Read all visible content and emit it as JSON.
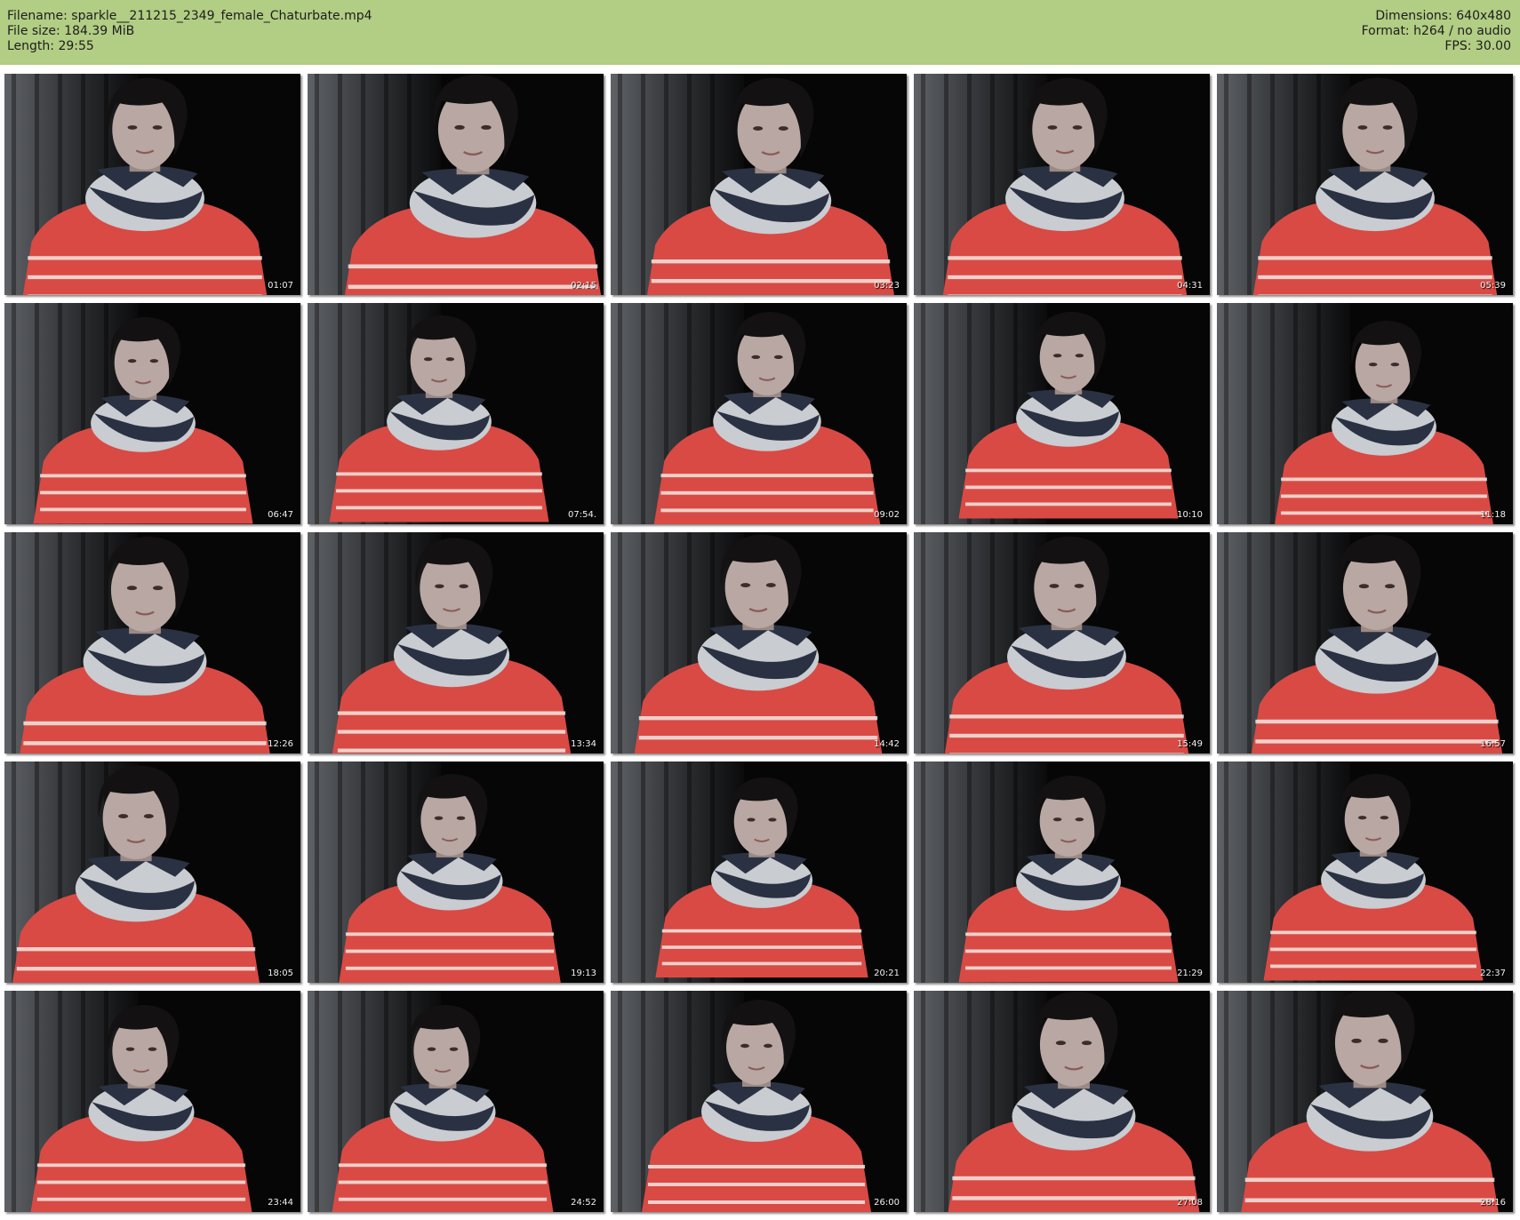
{
  "header": {
    "filename": "Filename: sparkle__211215_2349_female_Chaturbate.mp4",
    "filesize": "File size: 184.39 MiB",
    "length": "Length: 29:55",
    "dimensions": "Dimensions: 640x480",
    "format": "Format: h264 / no audio",
    "fps": "FPS: 30.00"
  },
  "colors": {
    "header_bg": "#b2cd84",
    "sweater": "#d94a45",
    "scarf_dark": "#2a3142",
    "scarf_light": "#c9ccd0",
    "curtain": "#5f6266"
  },
  "thumbnails": [
    {
      "timestamp": "01:07"
    },
    {
      "timestamp": "02:15"
    },
    {
      "timestamp": "03:23"
    },
    {
      "timestamp": "04:31"
    },
    {
      "timestamp": "05:39"
    },
    {
      "timestamp": "06:47"
    },
    {
      "timestamp": "07:54."
    },
    {
      "timestamp": "09:02"
    },
    {
      "timestamp": "10:10"
    },
    {
      "timestamp": "11:18"
    },
    {
      "timestamp": "12:26"
    },
    {
      "timestamp": "13:34"
    },
    {
      "timestamp": "14:42"
    },
    {
      "timestamp": "15:49"
    },
    {
      "timestamp": "16:57"
    },
    {
      "timestamp": "18:05"
    },
    {
      "timestamp": "19:13"
    },
    {
      "timestamp": "20:21"
    },
    {
      "timestamp": "21:29"
    },
    {
      "timestamp": "22:37"
    },
    {
      "timestamp": "23:44"
    },
    {
      "timestamp": "24:52"
    },
    {
      "timestamp": "26:00"
    },
    {
      "timestamp": "27:08"
    },
    {
      "timestamp": "28:16"
    }
  ]
}
